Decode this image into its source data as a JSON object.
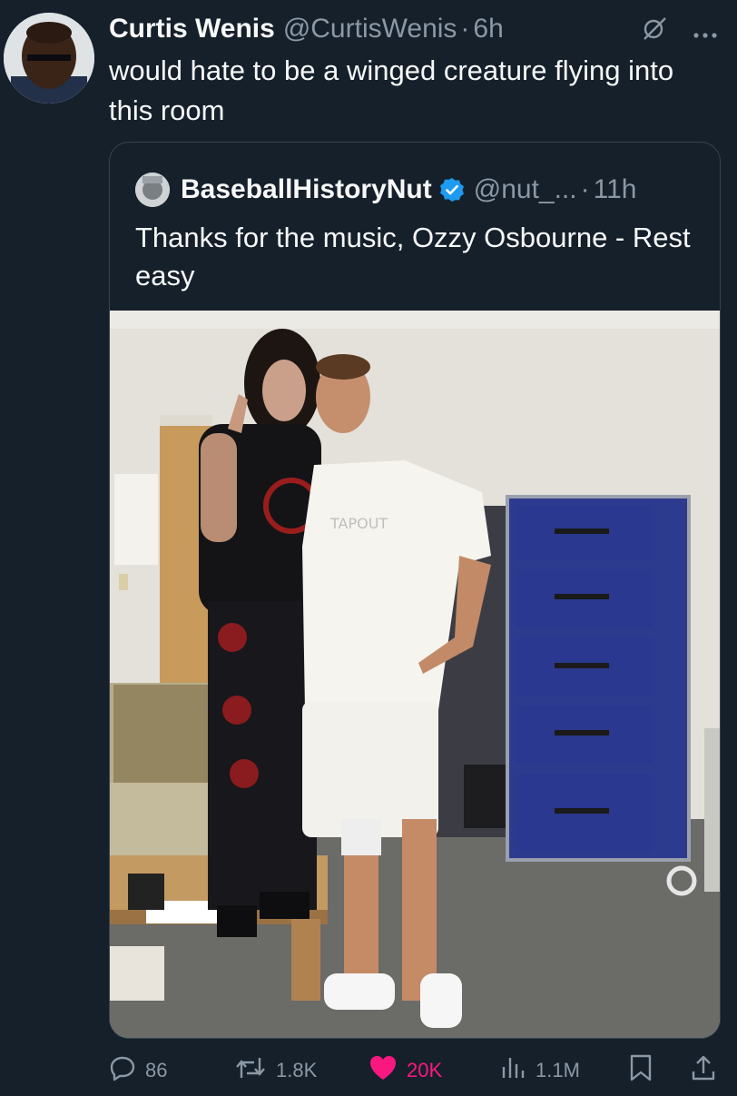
{
  "tweet": {
    "author_name": "Curtis Wenis",
    "author_handle": "@CurtisWenis",
    "separator": "·",
    "time": "6h",
    "text": "would hate to be a winged creature flying into this room"
  },
  "quote": {
    "author_name": "BaseballHistoryNut",
    "author_handle": "@nut_...",
    "separator": "·",
    "time": "11h",
    "text": "Thanks for the music, Ozzy Osbourne - Rest easy",
    "shirt_logo_text": "TAPOUT"
  },
  "actions": {
    "replies": "86",
    "retweets": "1.8K",
    "likes": "20K",
    "views": "1.1M"
  },
  "colors": {
    "background": "#15202b",
    "muted": "#8b98a5",
    "like": "#f91880",
    "verified": "#1d9bf0"
  },
  "icons": [
    "grok-icon",
    "more-icon",
    "verified-icon",
    "reply-icon",
    "retweet-icon",
    "heart-icon",
    "views-icon",
    "bookmark-icon",
    "share-icon"
  ]
}
